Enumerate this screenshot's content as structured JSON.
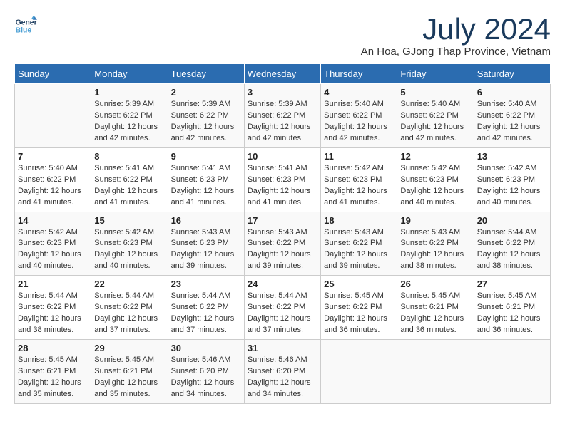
{
  "header": {
    "logo_line1": "General",
    "logo_line2": "Blue",
    "month": "July 2024",
    "location": "An Hoa, GJong Thap Province, Vietnam"
  },
  "weekdays": [
    "Sunday",
    "Monday",
    "Tuesday",
    "Wednesday",
    "Thursday",
    "Friday",
    "Saturday"
  ],
  "weeks": [
    [
      {
        "day": "",
        "info": ""
      },
      {
        "day": "1",
        "info": "Sunrise: 5:39 AM\nSunset: 6:22 PM\nDaylight: 12 hours\nand 42 minutes."
      },
      {
        "day": "2",
        "info": "Sunrise: 5:39 AM\nSunset: 6:22 PM\nDaylight: 12 hours\nand 42 minutes."
      },
      {
        "day": "3",
        "info": "Sunrise: 5:39 AM\nSunset: 6:22 PM\nDaylight: 12 hours\nand 42 minutes."
      },
      {
        "day": "4",
        "info": "Sunrise: 5:40 AM\nSunset: 6:22 PM\nDaylight: 12 hours\nand 42 minutes."
      },
      {
        "day": "5",
        "info": "Sunrise: 5:40 AM\nSunset: 6:22 PM\nDaylight: 12 hours\nand 42 minutes."
      },
      {
        "day": "6",
        "info": "Sunrise: 5:40 AM\nSunset: 6:22 PM\nDaylight: 12 hours\nand 42 minutes."
      }
    ],
    [
      {
        "day": "7",
        "info": "Sunrise: 5:40 AM\nSunset: 6:22 PM\nDaylight: 12 hours\nand 41 minutes."
      },
      {
        "day": "8",
        "info": "Sunrise: 5:41 AM\nSunset: 6:22 PM\nDaylight: 12 hours\nand 41 minutes."
      },
      {
        "day": "9",
        "info": "Sunrise: 5:41 AM\nSunset: 6:23 PM\nDaylight: 12 hours\nand 41 minutes."
      },
      {
        "day": "10",
        "info": "Sunrise: 5:41 AM\nSunset: 6:23 PM\nDaylight: 12 hours\nand 41 minutes."
      },
      {
        "day": "11",
        "info": "Sunrise: 5:42 AM\nSunset: 6:23 PM\nDaylight: 12 hours\nand 41 minutes."
      },
      {
        "day": "12",
        "info": "Sunrise: 5:42 AM\nSunset: 6:23 PM\nDaylight: 12 hours\nand 40 minutes."
      },
      {
        "day": "13",
        "info": "Sunrise: 5:42 AM\nSunset: 6:23 PM\nDaylight: 12 hours\nand 40 minutes."
      }
    ],
    [
      {
        "day": "14",
        "info": "Sunrise: 5:42 AM\nSunset: 6:23 PM\nDaylight: 12 hours\nand 40 minutes."
      },
      {
        "day": "15",
        "info": "Sunrise: 5:42 AM\nSunset: 6:23 PM\nDaylight: 12 hours\nand 40 minutes."
      },
      {
        "day": "16",
        "info": "Sunrise: 5:43 AM\nSunset: 6:23 PM\nDaylight: 12 hours\nand 39 minutes."
      },
      {
        "day": "17",
        "info": "Sunrise: 5:43 AM\nSunset: 6:22 PM\nDaylight: 12 hours\nand 39 minutes."
      },
      {
        "day": "18",
        "info": "Sunrise: 5:43 AM\nSunset: 6:22 PM\nDaylight: 12 hours\nand 39 minutes."
      },
      {
        "day": "19",
        "info": "Sunrise: 5:43 AM\nSunset: 6:22 PM\nDaylight: 12 hours\nand 38 minutes."
      },
      {
        "day": "20",
        "info": "Sunrise: 5:44 AM\nSunset: 6:22 PM\nDaylight: 12 hours\nand 38 minutes."
      }
    ],
    [
      {
        "day": "21",
        "info": "Sunrise: 5:44 AM\nSunset: 6:22 PM\nDaylight: 12 hours\nand 38 minutes."
      },
      {
        "day": "22",
        "info": "Sunrise: 5:44 AM\nSunset: 6:22 PM\nDaylight: 12 hours\nand 37 minutes."
      },
      {
        "day": "23",
        "info": "Sunrise: 5:44 AM\nSunset: 6:22 PM\nDaylight: 12 hours\nand 37 minutes."
      },
      {
        "day": "24",
        "info": "Sunrise: 5:44 AM\nSunset: 6:22 PM\nDaylight: 12 hours\nand 37 minutes."
      },
      {
        "day": "25",
        "info": "Sunrise: 5:45 AM\nSunset: 6:22 PM\nDaylight: 12 hours\nand 36 minutes."
      },
      {
        "day": "26",
        "info": "Sunrise: 5:45 AM\nSunset: 6:21 PM\nDaylight: 12 hours\nand 36 minutes."
      },
      {
        "day": "27",
        "info": "Sunrise: 5:45 AM\nSunset: 6:21 PM\nDaylight: 12 hours\nand 36 minutes."
      }
    ],
    [
      {
        "day": "28",
        "info": "Sunrise: 5:45 AM\nSunset: 6:21 PM\nDaylight: 12 hours\nand 35 minutes."
      },
      {
        "day": "29",
        "info": "Sunrise: 5:45 AM\nSunset: 6:21 PM\nDaylight: 12 hours\nand 35 minutes."
      },
      {
        "day": "30",
        "info": "Sunrise: 5:46 AM\nSunset: 6:20 PM\nDaylight: 12 hours\nand 34 minutes."
      },
      {
        "day": "31",
        "info": "Sunrise: 5:46 AM\nSunset: 6:20 PM\nDaylight: 12 hours\nand 34 minutes."
      },
      {
        "day": "",
        "info": ""
      },
      {
        "day": "",
        "info": ""
      },
      {
        "day": "",
        "info": ""
      }
    ]
  ]
}
